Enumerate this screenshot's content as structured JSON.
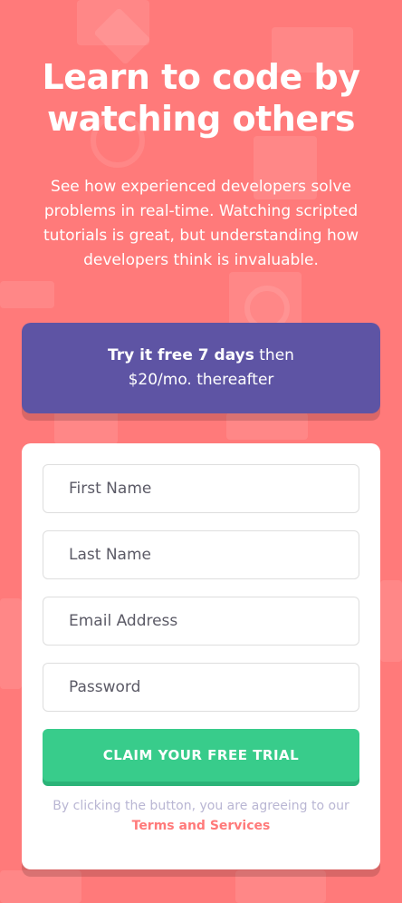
{
  "hero": {
    "headline": "Learn to code by watching others",
    "intro": "See how experienced developers solve problems in real-time. Watching scripted tutorials is great, but understanding how developers think is invaluable."
  },
  "offer": {
    "bold": "Try it free 7 days",
    "rest_line1": " then",
    "rest_line2": "$20/mo. thereafter"
  },
  "form": {
    "first_name_placeholder": "First Name",
    "last_name_placeholder": "Last Name",
    "email_placeholder": "Email Address",
    "password_placeholder": "Password",
    "submit_label": "CLAIM YOUR FREE TRIAL",
    "terms_text": "By clicking the button, you are agreeing to our ",
    "terms_link": "Terms and Services"
  },
  "colors": {
    "background": "#ff7a7a",
    "offer_bg": "#5e54a4",
    "cta_bg": "#38cc8b",
    "link": "#ff7a7a"
  }
}
